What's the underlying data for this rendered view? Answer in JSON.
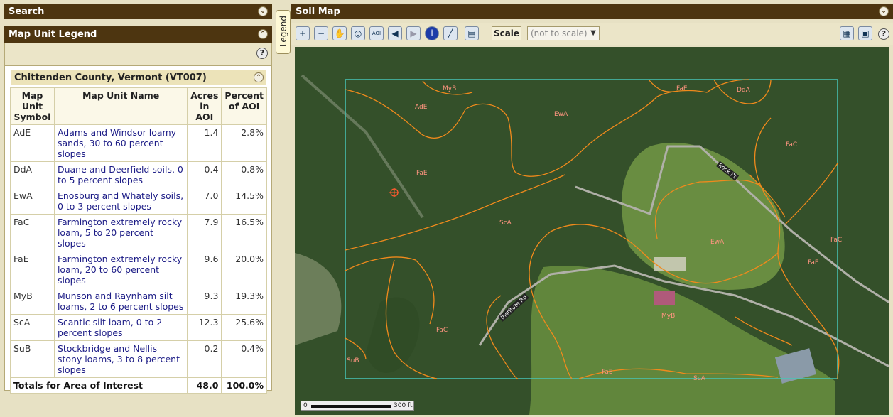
{
  "search": {
    "title": "Search"
  },
  "legend": {
    "title": "Map Unit Legend",
    "county": "Chittenden County, Vermont (VT007)",
    "columns": [
      "Map Unit Symbol",
      "Map Unit Name",
      "Acres in AOI",
      "Percent of AOI"
    ],
    "rows": [
      {
        "symbol": "AdE",
        "name": "Adams and Windsor loamy sands, 30 to 60 percent slopes",
        "acres": "1.4",
        "percent": "2.8%"
      },
      {
        "symbol": "DdA",
        "name": "Duane and Deerfield soils, 0 to 5 percent slopes",
        "acres": "0.4",
        "percent": "0.8%"
      },
      {
        "symbol": "EwA",
        "name": "Enosburg and Whately soils, 0 to 3 percent slopes",
        "acres": "7.0",
        "percent": "14.5%"
      },
      {
        "symbol": "FaC",
        "name": "Farmington extremely rocky loam, 5 to 20 percent slopes",
        "acres": "7.9",
        "percent": "16.5%"
      },
      {
        "symbol": "FaE",
        "name": "Farmington extremely rocky loam, 20 to 60 percent slopes",
        "acres": "9.6",
        "percent": "20.0%"
      },
      {
        "symbol": "MyB",
        "name": "Munson and Raynham silt loams, 2 to 6 percent slopes",
        "acres": "9.3",
        "percent": "19.3%"
      },
      {
        "symbol": "ScA",
        "name": "Scantic silt loam, 0 to 2 percent slopes",
        "acres": "12.3",
        "percent": "25.6%"
      },
      {
        "symbol": "SuB",
        "name": "Stockbridge and Nellis stony loams, 3 to 8 percent slopes",
        "acres": "0.2",
        "percent": "0.4%"
      }
    ],
    "total": {
      "label": "Totals for Area of Interest",
      "acres": "48.0",
      "percent": "100.0%"
    }
  },
  "legend_tab": "Legend",
  "soil_map": {
    "title": "Soil Map",
    "scale_label": "Scale",
    "scale_value": "(not to scale)",
    "map_labels": [
      "MyB",
      "AdE",
      "EwA",
      "FaE",
      "DdA",
      "FaC",
      "FaE",
      "ScA",
      "EwA",
      "FaC",
      "FaE",
      "MyB",
      "FaC",
      "SuB",
      "FaE",
      "ScA"
    ],
    "roads": [
      "Rock Pt",
      "Institute Rd"
    ],
    "scalebar": {
      "start": "0",
      "end": "300 ft"
    }
  }
}
